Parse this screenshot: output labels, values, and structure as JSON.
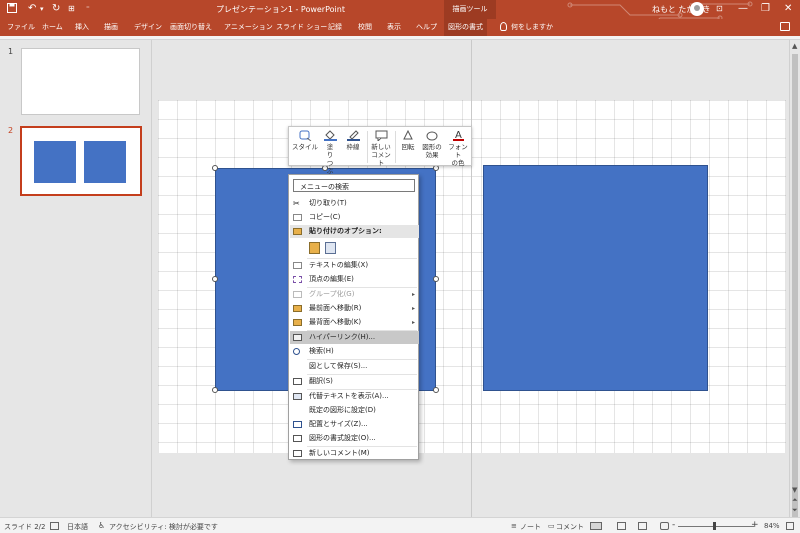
{
  "app": {
    "title": "プレゼンテーション1 - PowerPoint",
    "context_tool_group": "描画ツール",
    "user_name": "ねもと たかあき",
    "qat": {
      "save_icon": "save-icon",
      "undo_icon": "undo-icon",
      "redo_icon": "redo-icon",
      "present_icon": "present-icon",
      "more_icon": "more-icon"
    },
    "window_controls": {
      "ribbon_options": "ribbon-display-options-icon",
      "minimize": "—",
      "restore": "❐",
      "close": "✕"
    }
  },
  "tabs": [
    "ファイル",
    "ホーム",
    "挿入",
    "描画",
    "デザイン",
    "画面切り替え",
    "アニメーション",
    "スライド ショー",
    "記録",
    "校閲",
    "表示",
    "ヘルプ",
    "図形の書式"
  ],
  "active_tab": "図形の書式",
  "tell_me": "何をしますか",
  "slides_panel": {
    "slides": [
      {
        "number": "1",
        "shapes": 0
      },
      {
        "number": "2",
        "shapes": 2
      }
    ],
    "selected": "2"
  },
  "mini_toolbar": {
    "buttons": [
      {
        "label": "スタイル",
        "icon": "shape-style-icon"
      },
      {
        "label": "塗りつぶし",
        "icon": "fill-bucket-icon"
      },
      {
        "label": "枠線",
        "icon": "outline-pen-icon"
      },
      {
        "label": "新しい\nコメント",
        "icon": "new-comment-icon"
      },
      {
        "label": "回転",
        "icon": "rotate-icon"
      },
      {
        "label": "図形の\n効果",
        "icon": "shape-effects-icon"
      },
      {
        "label": "フォント\nの色",
        "icon": "font-color-icon"
      }
    ]
  },
  "context_menu": {
    "search_placeholder": "メニューの検索",
    "items": [
      {
        "label": "切り取り(T)",
        "enabled": true
      },
      {
        "label": "コピー(C)",
        "enabled": true
      },
      {
        "label": "貼り付けのオプション:",
        "enabled": true,
        "header": true
      },
      {
        "label": "テキストの編集(X)",
        "enabled": true
      },
      {
        "label": "頂点の編集(E)",
        "enabled": true
      },
      {
        "label": "グループ化(G)",
        "enabled": false,
        "submenu": true
      },
      {
        "label": "最前面へ移動(R)",
        "enabled": true,
        "submenu": true
      },
      {
        "label": "最背面へ移動(K)",
        "enabled": true,
        "submenu": true
      },
      {
        "label": "ハイパーリンク(H)...",
        "enabled": true,
        "highlighted": true
      },
      {
        "label": "検索(H)",
        "enabled": true
      },
      {
        "label": "図として保存(S)...",
        "enabled": true
      },
      {
        "label": "翻訳(S)",
        "enabled": true
      },
      {
        "label": "代替テキストを表示(A)...",
        "enabled": true
      },
      {
        "label": "既定の図形に設定(D)",
        "enabled": true
      },
      {
        "label": "配置とサイズ(Z)...",
        "enabled": true
      },
      {
        "label": "図形の書式設定(O)...",
        "enabled": true
      },
      {
        "label": "新しいコメント(M)",
        "enabled": true
      }
    ]
  },
  "status_bar": {
    "slide_counter": "スライド 2/2",
    "language": "日本語",
    "accessibility": "アクセシビリティ: 検討が必要です",
    "notes": "ノート",
    "comments": "コメント",
    "zoom_minus": "-",
    "zoom_plus": "+",
    "zoom": "84%"
  },
  "colors": {
    "brand": "#b7472a",
    "shape_fill": "#4472c4",
    "selection_accent": "#c43e1c"
  }
}
